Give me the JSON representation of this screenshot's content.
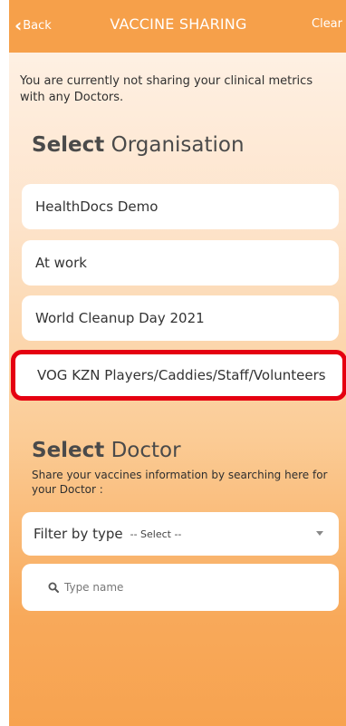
{
  "header": {
    "back_label": "Back",
    "title": "VACCINE SHARING",
    "clear_label": "Clear"
  },
  "notice": "You are currently not sharing your clinical metrics with any Doctors.",
  "organisation": {
    "heading_bold": "Select",
    "heading_rest": "Organisation",
    "items": [
      {
        "label": "HealthDocs Demo",
        "selected": false
      },
      {
        "label": "At work",
        "selected": false
      },
      {
        "label": "World Cleanup Day 2021",
        "selected": false
      },
      {
        "label": "VOG KZN Players/Caddies/Staff/Volunteers",
        "selected": true
      }
    ]
  },
  "doctor": {
    "heading_bold": "Select",
    "heading_rest": "Doctor",
    "subtitle": "Share your vaccines information by searching here for your Doctor :",
    "filter_label": "Filter by type",
    "filter_value": "-- Select --",
    "search_placeholder": "Type name"
  },
  "colors": {
    "header": "#f6a04a",
    "selected_outline": "#e50011"
  }
}
